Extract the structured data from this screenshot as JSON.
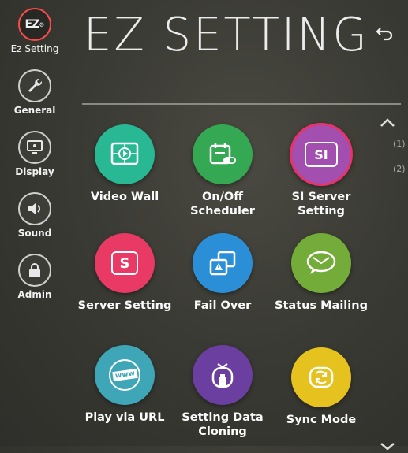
{
  "sidebar": {
    "items": [
      {
        "label": "Ez Setting",
        "icon": "ez-setting-icon",
        "glyph": "EZ"
      },
      {
        "label": "General",
        "icon": "wrench-icon"
      },
      {
        "label": "Display",
        "icon": "display-icon"
      },
      {
        "label": "Sound",
        "icon": "speaker-icon"
      },
      {
        "label": "Admin",
        "icon": "lock-icon"
      }
    ]
  },
  "header": {
    "title": "EZ SETTING",
    "back_icon": "back-icon"
  },
  "grid": {
    "tiles": [
      {
        "label": "Video Wall",
        "color": "#29b894",
        "icon": "video-wall-icon"
      },
      {
        "label1": "On/Off",
        "label2": "Scheduler",
        "color": "#34a853",
        "icon": "scheduler-icon"
      },
      {
        "label1": "SI Server",
        "label2": "Setting",
        "color": "#a24fb0",
        "icon": "si-server-icon",
        "glyph": "SI"
      },
      {
        "label": "Server Setting",
        "color": "#e83a64",
        "icon": "server-setting-icon",
        "glyph": "S"
      },
      {
        "label": "Fail Over",
        "color": "#2b8fd8",
        "icon": "fail-over-icon"
      },
      {
        "label": "Status Mailing",
        "color": "#74ac3a",
        "icon": "mail-icon"
      },
      {
        "label": "Play via URL",
        "color": "#3fa6b8",
        "icon": "play-url-icon",
        "glyph": "www"
      },
      {
        "label1": "Setting Data",
        "label2": "Cloning",
        "color": "#6b3fa0",
        "icon": "cloning-icon"
      },
      {
        "label": "Sync Mode",
        "color": "#e6c21e",
        "icon": "sync-icon"
      }
    ]
  },
  "side_page_marks": [
    "(1)",
    "(2)"
  ]
}
